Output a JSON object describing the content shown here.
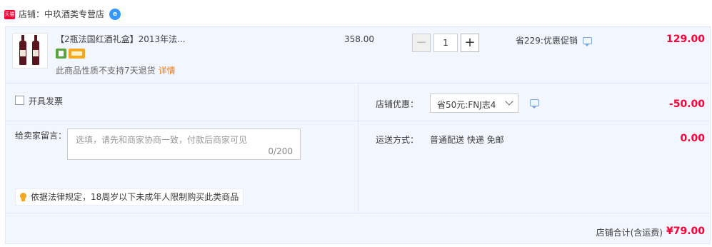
{
  "shop": {
    "badge": "天猫",
    "label": "店铺：中玖酒类专营店",
    "ww_icon": "wangwang-chat-icon"
  },
  "item": {
    "title": "【2瓶法国红酒礼盒】2013年法...",
    "service_icons": [
      "seven-day-service-icon",
      "credit-card-icon"
    ],
    "note": "此商品性质不支持7天退货",
    "note_link": "详情",
    "unit_price": "358.00",
    "qty_minus": "−",
    "qty_value": "1",
    "qty_plus": "+",
    "promo": "省229:优惠促销",
    "total": "129.00"
  },
  "invoice": {
    "label": "开具发票"
  },
  "message": {
    "label": "给卖家留言：",
    "placeholder": "选填，请先和商家协商一致，付款后商家可见",
    "count": "0/200"
  },
  "law_note": "依据法律规定，18周岁以下未成年人限制购买此类商品",
  "discount": {
    "label": "店铺优惠：",
    "selected": "省50元:FNJ志4",
    "amount": "-50.00"
  },
  "shipping": {
    "label": "运送方式：",
    "value": "普通配送 快递 免邮",
    "fee": "0.00"
  },
  "summary": {
    "label": "店铺合计(含运费)",
    "amount": "¥79.00"
  },
  "colors": {
    "price_red": "#ff0036",
    "panel_bg": "#f2f7ff",
    "tmall_red": "#ff0036",
    "link_orange": "#f37b1d"
  }
}
